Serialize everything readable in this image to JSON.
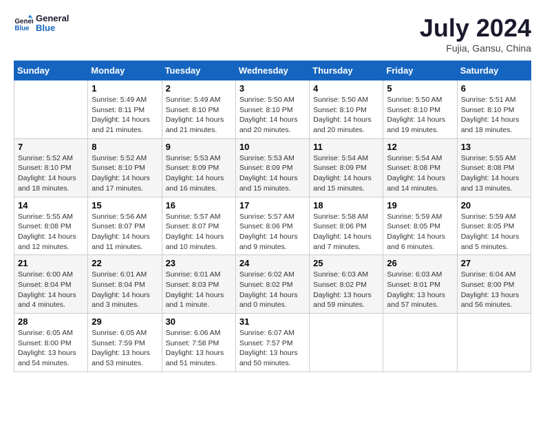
{
  "header": {
    "logo_general": "General",
    "logo_blue": "Blue",
    "month_year": "July 2024",
    "location": "Fujia, Gansu, China"
  },
  "weekdays": [
    "Sunday",
    "Monday",
    "Tuesday",
    "Wednesday",
    "Thursday",
    "Friday",
    "Saturday"
  ],
  "weeks": [
    [
      {
        "num": "",
        "info": ""
      },
      {
        "num": "1",
        "info": "Sunrise: 5:49 AM\nSunset: 8:11 PM\nDaylight: 14 hours\nand 21 minutes."
      },
      {
        "num": "2",
        "info": "Sunrise: 5:49 AM\nSunset: 8:10 PM\nDaylight: 14 hours\nand 21 minutes."
      },
      {
        "num": "3",
        "info": "Sunrise: 5:50 AM\nSunset: 8:10 PM\nDaylight: 14 hours\nand 20 minutes."
      },
      {
        "num": "4",
        "info": "Sunrise: 5:50 AM\nSunset: 8:10 PM\nDaylight: 14 hours\nand 20 minutes."
      },
      {
        "num": "5",
        "info": "Sunrise: 5:50 AM\nSunset: 8:10 PM\nDaylight: 14 hours\nand 19 minutes."
      },
      {
        "num": "6",
        "info": "Sunrise: 5:51 AM\nSunset: 8:10 PM\nDaylight: 14 hours\nand 18 minutes."
      }
    ],
    [
      {
        "num": "7",
        "info": "Sunrise: 5:52 AM\nSunset: 8:10 PM\nDaylight: 14 hours\nand 18 minutes."
      },
      {
        "num": "8",
        "info": "Sunrise: 5:52 AM\nSunset: 8:10 PM\nDaylight: 14 hours\nand 17 minutes."
      },
      {
        "num": "9",
        "info": "Sunrise: 5:53 AM\nSunset: 8:09 PM\nDaylight: 14 hours\nand 16 minutes."
      },
      {
        "num": "10",
        "info": "Sunrise: 5:53 AM\nSunset: 8:09 PM\nDaylight: 14 hours\nand 15 minutes."
      },
      {
        "num": "11",
        "info": "Sunrise: 5:54 AM\nSunset: 8:09 PM\nDaylight: 14 hours\nand 15 minutes."
      },
      {
        "num": "12",
        "info": "Sunrise: 5:54 AM\nSunset: 8:08 PM\nDaylight: 14 hours\nand 14 minutes."
      },
      {
        "num": "13",
        "info": "Sunrise: 5:55 AM\nSunset: 8:08 PM\nDaylight: 14 hours\nand 13 minutes."
      }
    ],
    [
      {
        "num": "14",
        "info": "Sunrise: 5:55 AM\nSunset: 8:08 PM\nDaylight: 14 hours\nand 12 minutes."
      },
      {
        "num": "15",
        "info": "Sunrise: 5:56 AM\nSunset: 8:07 PM\nDaylight: 14 hours\nand 11 minutes."
      },
      {
        "num": "16",
        "info": "Sunrise: 5:57 AM\nSunset: 8:07 PM\nDaylight: 14 hours\nand 10 minutes."
      },
      {
        "num": "17",
        "info": "Sunrise: 5:57 AM\nSunset: 8:06 PM\nDaylight: 14 hours\nand 9 minutes."
      },
      {
        "num": "18",
        "info": "Sunrise: 5:58 AM\nSunset: 8:06 PM\nDaylight: 14 hours\nand 7 minutes."
      },
      {
        "num": "19",
        "info": "Sunrise: 5:59 AM\nSunset: 8:05 PM\nDaylight: 14 hours\nand 6 minutes."
      },
      {
        "num": "20",
        "info": "Sunrise: 5:59 AM\nSunset: 8:05 PM\nDaylight: 14 hours\nand 5 minutes."
      }
    ],
    [
      {
        "num": "21",
        "info": "Sunrise: 6:00 AM\nSunset: 8:04 PM\nDaylight: 14 hours\nand 4 minutes."
      },
      {
        "num": "22",
        "info": "Sunrise: 6:01 AM\nSunset: 8:04 PM\nDaylight: 14 hours\nand 3 minutes."
      },
      {
        "num": "23",
        "info": "Sunrise: 6:01 AM\nSunset: 8:03 PM\nDaylight: 14 hours\nand 1 minute."
      },
      {
        "num": "24",
        "info": "Sunrise: 6:02 AM\nSunset: 8:02 PM\nDaylight: 14 hours\nand 0 minutes."
      },
      {
        "num": "25",
        "info": "Sunrise: 6:03 AM\nSunset: 8:02 PM\nDaylight: 13 hours\nand 59 minutes."
      },
      {
        "num": "26",
        "info": "Sunrise: 6:03 AM\nSunset: 8:01 PM\nDaylight: 13 hours\nand 57 minutes."
      },
      {
        "num": "27",
        "info": "Sunrise: 6:04 AM\nSunset: 8:00 PM\nDaylight: 13 hours\nand 56 minutes."
      }
    ],
    [
      {
        "num": "28",
        "info": "Sunrise: 6:05 AM\nSunset: 8:00 PM\nDaylight: 13 hours\nand 54 minutes."
      },
      {
        "num": "29",
        "info": "Sunrise: 6:05 AM\nSunset: 7:59 PM\nDaylight: 13 hours\nand 53 minutes."
      },
      {
        "num": "30",
        "info": "Sunrise: 6:06 AM\nSunset: 7:58 PM\nDaylight: 13 hours\nand 51 minutes."
      },
      {
        "num": "31",
        "info": "Sunrise: 6:07 AM\nSunset: 7:57 PM\nDaylight: 13 hours\nand 50 minutes."
      },
      {
        "num": "",
        "info": ""
      },
      {
        "num": "",
        "info": ""
      },
      {
        "num": "",
        "info": ""
      }
    ]
  ]
}
